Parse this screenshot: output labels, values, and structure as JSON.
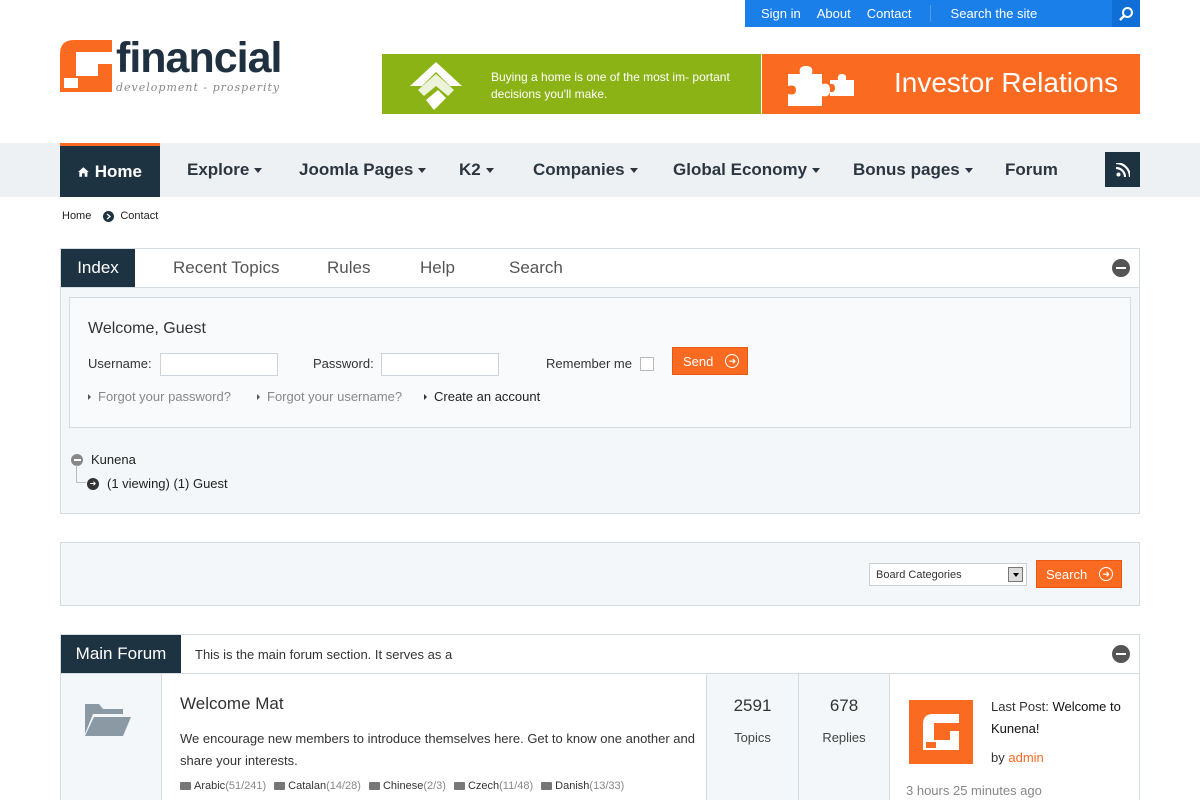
{
  "topbar": {
    "links": [
      "Sign in",
      "About",
      "Contact"
    ],
    "search_placeholder": "Search the site"
  },
  "logo": {
    "word": "financial",
    "tagline": "development - prosperity"
  },
  "banners": {
    "green_text": "Buying a home is one of the most im- portant decisions you'll make.",
    "orange_text": "Investor Relations"
  },
  "nav": {
    "items": [
      {
        "label": "Home",
        "dropdown": false
      },
      {
        "label": "Explore",
        "dropdown": true
      },
      {
        "label": "Joomla Pages",
        "dropdown": true
      },
      {
        "label": "K2",
        "dropdown": true
      },
      {
        "label": "Companies",
        "dropdown": true
      },
      {
        "label": "Global Economy",
        "dropdown": true
      },
      {
        "label": "Bonus pages",
        "dropdown": true
      },
      {
        "label": "Forum",
        "dropdown": false
      }
    ]
  },
  "breadcrumb": [
    "Home",
    "Contact"
  ],
  "forum_tabs": [
    "Index",
    "Recent Topics",
    "Rules",
    "Help",
    "Search"
  ],
  "login": {
    "welcome": "Welcome, Guest",
    "username_label": "Username:",
    "password_label": "Password:",
    "remember_label": "Remember me",
    "send_label": "Send",
    "forgot_password": "Forgot your password?",
    "forgot_username": "Forgot your username?",
    "create_account": "Create an account"
  },
  "stats": {
    "board": "Kunena",
    "viewing": "(1 viewing) (1) Guest"
  },
  "search_panel": {
    "select_value": "Board Categories",
    "button_label": "Search"
  },
  "main_forum": {
    "title": "Main Forum",
    "description": "This is the main forum section. It serves as a",
    "category_title": "Welcome Mat",
    "category_desc": "We encourage new members to introduce themselves here. Get to know one another and share your interests.",
    "subcategories": [
      {
        "name": "Arabic",
        "count": "(51/241)"
      },
      {
        "name": "Catalan",
        "count": "(14/28)"
      },
      {
        "name": "Chinese",
        "count": "(2/3)"
      },
      {
        "name": "Czech",
        "count": "(11/48)"
      },
      {
        "name": "Danish",
        "count": "(13/33)"
      }
    ],
    "topics_value": "2591",
    "topics_label": "Topics",
    "replies_value": "678",
    "replies_label": "Replies",
    "last_post_prefix": "Last Post:",
    "last_post_title": "Welcome to Kunena!",
    "by_label": "by",
    "author": "admin",
    "time_ago": "3 hours 25 minutes ago"
  },
  "colors": {
    "accent_orange": "#fb6a21",
    "navy": "#1d3342",
    "blue": "#1a7fe8",
    "green": "#8cb315"
  }
}
